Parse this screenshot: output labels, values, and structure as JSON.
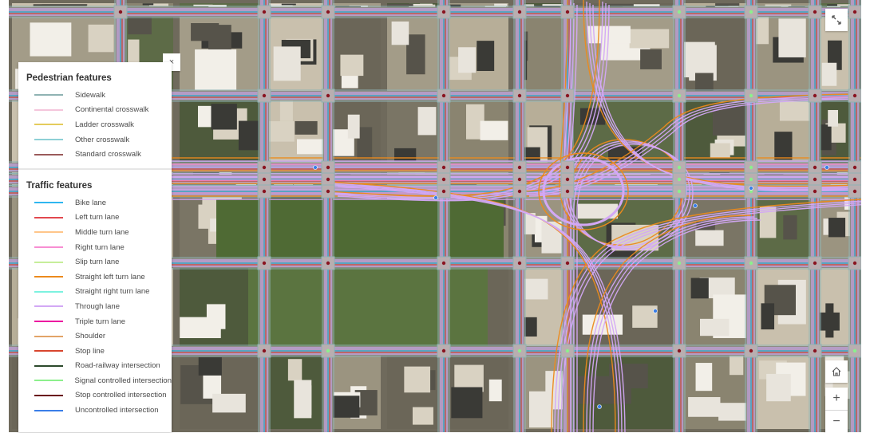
{
  "legend": {
    "close_icon": "close-icon",
    "sections": [
      {
        "title": "Pedestrian features",
        "items": [
          {
            "label": "Sidewalk",
            "color": "#8fb3b3"
          },
          {
            "label": "Continental crosswalk",
            "color": "#f5c6dc"
          },
          {
            "label": "Ladder crosswalk",
            "color": "#e4cc5c"
          },
          {
            "label": "Other crosswalk",
            "color": "#8ed0d6"
          },
          {
            "label": "Standard crosswalk",
            "color": "#9a5a5a"
          }
        ]
      },
      {
        "title": "Traffic features",
        "items": [
          {
            "label": "Bike lane",
            "color": "#2fb6f0"
          },
          {
            "label": "Left turn lane",
            "color": "#e2484f"
          },
          {
            "label": "Middle turn lane",
            "color": "#ffc68a"
          },
          {
            "label": "Right turn lane",
            "color": "#f78ed2"
          },
          {
            "label": "Slip turn lane",
            "color": "#c6ee9a"
          },
          {
            "label": "Straight left turn lane",
            "color": "#ec8a1c"
          },
          {
            "label": "Straight right turn lane",
            "color": "#7cf2e0"
          },
          {
            "label": "Through lane",
            "color": "#d3a8f5"
          },
          {
            "label": "Triple turn lane",
            "color": "#ec1aa0"
          },
          {
            "label": "Shoulder",
            "color": "#e2a468"
          },
          {
            "label": "Stop line",
            "color": "#d8462e"
          },
          {
            "label": "Road-railway intersection",
            "color": "#2c4a2c"
          },
          {
            "label": "Signal controlled intersection",
            "color": "#8cf08c"
          },
          {
            "label": "Stop controlled intersection",
            "color": "#6a0a14"
          },
          {
            "label": "Uncontrolled intersection",
            "color": "#3a7ee8"
          }
        ]
      }
    ]
  },
  "controls": {
    "fullscreen_icon": "expand-icon",
    "home_icon": "home-icon",
    "zoom_in_label": "+",
    "zoom_out_label": "−",
    "close_label": "×"
  }
}
